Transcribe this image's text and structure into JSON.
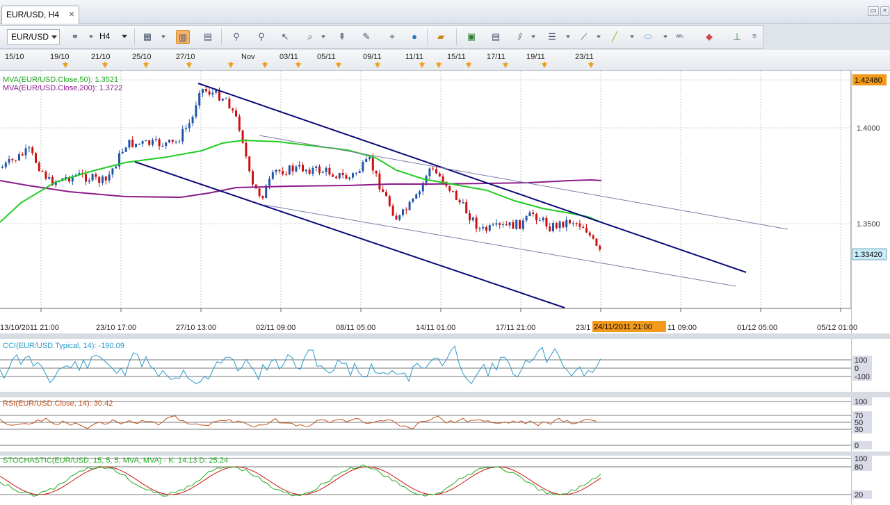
{
  "window": {
    "tab_title": "EUR/USD, H4",
    "tab_close": "×",
    "restore_symbol": "▭",
    "close_symbol": "×"
  },
  "toolbar": {
    "symbol_value": "EUR/USD",
    "timeframe_value": "H4",
    "icons": [
      "chart-settings-icon",
      "bar-chart-icon",
      "candle-chart-icon",
      "indicator-icon",
      "zoom-in-icon",
      "zoom-out-icon",
      "pointer-icon",
      "zoom-area-icon",
      "levels-icon",
      "edit-chart-icon",
      "crosshair-icon",
      "globe-icon",
      "ruler-icon",
      "image-icon",
      "template-icon",
      "fibonacci-icon",
      "channel-icon",
      "trendline-icon",
      "pen-icon",
      "ellipse-icon",
      "text-icon",
      "eraser-icon",
      "objects-tree-icon"
    ]
  },
  "date_strip": {
    "labels": [
      "15/10",
      "19/10",
      "21/10",
      "25/10",
      "27/10",
      "Nov",
      "03/11",
      "05/11",
      "09/11",
      "11/11",
      "15/11",
      "17/11",
      "19/11",
      "23/11"
    ]
  },
  "price_panel": {
    "legend_mva50": "MVA(EUR/USD.Close,50): 1.3521",
    "legend_mva200": "MVA(EUR/USD.Close,200): 1.3722",
    "price_axis": [
      "1.4000",
      "1.3500"
    ],
    "high_label": "1.42480",
    "current_label": "1.33420",
    "time_axis": [
      "13/10/2011 21:00",
      "23/10 17:00",
      "27/10 13:00",
      "02/11 09:00",
      "08/11 05:00",
      "14/11 01:00",
      "17/11 21:00",
      "23/1",
      "11 09:00",
      "01/12 05:00",
      "05/12 01:00"
    ],
    "cursor_time": "24/11/2011 21:00",
    "colors": {
      "mva50": "#22cc22",
      "mva200": "#8b1a8b",
      "channel": "#0b0b7a",
      "bull": "#2255aa",
      "bear": "#cc1111",
      "highlight": "#f29a1c"
    }
  },
  "cci_panel": {
    "legend": "CCI(EUR/USD.Typical, 14): -190.09",
    "levels": [
      "100",
      "0",
      "-100"
    ]
  },
  "rsi_panel": {
    "legend": "RSI(EUR/USD.Close, 14): 30.42",
    "levels": [
      "100",
      "70",
      "50",
      "30",
      "0"
    ]
  },
  "stoch_panel": {
    "legend": "STOCHASTIC(EUR/USD, 15, 5, 5, MVA, MVA) -  K: 14.13  D: 25.24",
    "levels": [
      "100",
      "80",
      "20"
    ]
  }
}
